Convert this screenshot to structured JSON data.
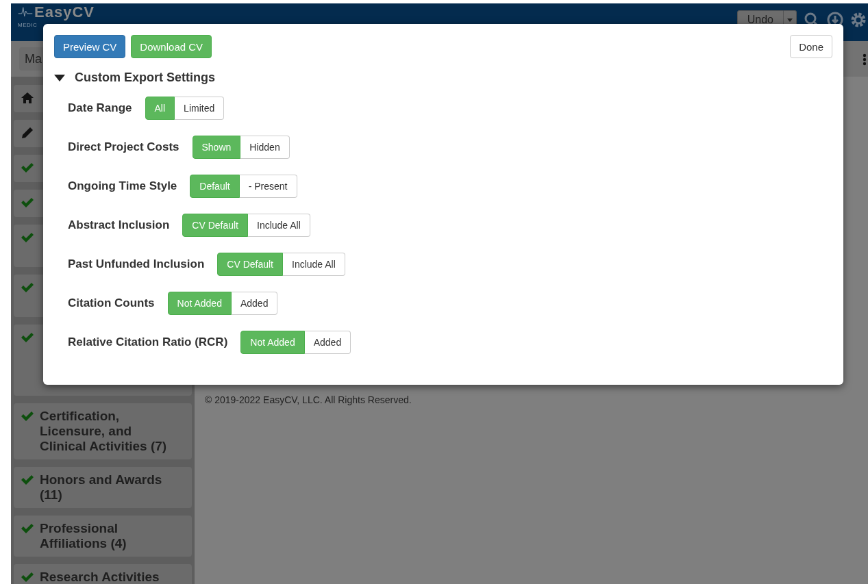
{
  "header": {
    "logo": "EasyCV",
    "tagline": "MEDIC",
    "undo_button": "Undo"
  },
  "cv_select": {
    "value": "Ma"
  },
  "sidebar": {
    "items": [
      {
        "kind": "home"
      },
      {
        "kind": "edit"
      },
      {
        "kind": "check"
      },
      {
        "kind": "check"
      },
      {
        "kind": "check"
      },
      {
        "kind": "check"
      },
      {
        "kind": "check"
      },
      {
        "kind": "check",
        "label": "Certification, Licensure, and Clinical Activities (7)"
      },
      {
        "kind": "check",
        "label": "Honors and Awards (11)"
      },
      {
        "kind": "check",
        "label": "Professional Affiliations (4)"
      },
      {
        "kind": "check",
        "label": "Research Activities"
      }
    ]
  },
  "footer": "© 2019-2022 EasyCV, LLC. All Rights Reserved.",
  "dialog": {
    "buttons": [
      "Preview CV",
      "Download CV"
    ],
    "done_button": "Done",
    "section": {
      "title": "Custom Export Settings",
      "expanded": true,
      "settings": [
        {
          "label": "Date Range",
          "options": [
            {
              "label": "All",
              "selected": true
            },
            {
              "label": "Limited",
              "selected": false
            }
          ]
        },
        {
          "label": "Direct Project Costs",
          "options": [
            {
              "label": "Shown",
              "selected": true
            },
            {
              "label": "Hidden",
              "selected": false
            }
          ]
        },
        {
          "label": "Ongoing Time Style",
          "options": [
            {
              "label": "Default",
              "selected": true
            },
            {
              "label": "- Present",
              "selected": false
            }
          ]
        },
        {
          "label": "Abstract Inclusion",
          "options": [
            {
              "label": "CV Default",
              "selected": true
            },
            {
              "label": "Include All",
              "selected": false
            }
          ]
        },
        {
          "label": "Past Unfunded Inclusion",
          "options": [
            {
              "label": "CV Default",
              "selected": true
            },
            {
              "label": "Include All",
              "selected": false
            }
          ]
        },
        {
          "label": "Citation Counts",
          "options": [
            {
              "label": "Not Added",
              "selected": true
            },
            {
              "label": "Added",
              "selected": false
            }
          ]
        },
        {
          "label": "Relative Citation Ratio (RCR)",
          "options": [
            {
              "label": "Not Added",
              "selected": true
            },
            {
              "label": "Added",
              "selected": false
            }
          ]
        }
      ]
    }
  }
}
